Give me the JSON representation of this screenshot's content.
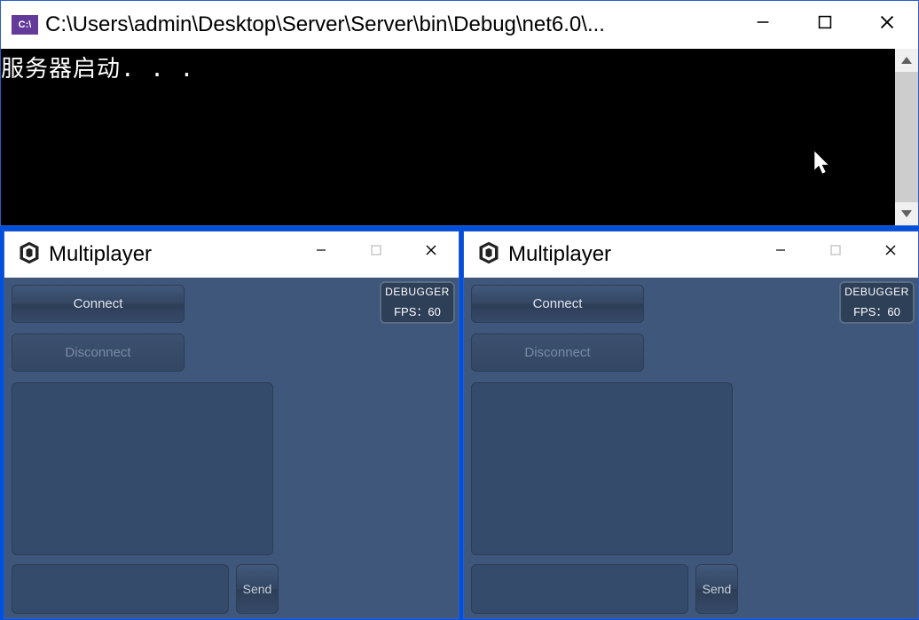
{
  "console": {
    "title": "C:\\Users\\admin\\Desktop\\Server\\Server\\bin\\Debug\\net6.0\\...",
    "output": "服务器启动. . ."
  },
  "unity": {
    "title": "Multiplayer",
    "buttons": {
      "connect": "Connect",
      "disconnect": "Disconnect",
      "send": "Send"
    },
    "debugger": {
      "title": "DEBUGGER",
      "fps_label": "FPS：",
      "fps_value": "60"
    }
  }
}
